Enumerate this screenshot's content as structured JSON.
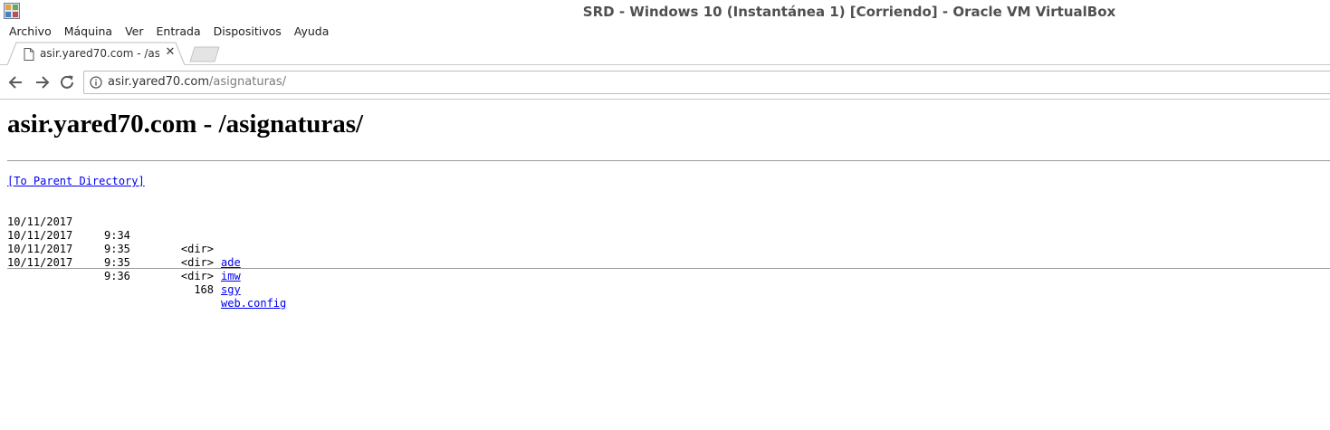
{
  "window": {
    "title": "SRD - Windows 10 (Instantánea 1) [Corriendo] - Oracle VM VirtualBox",
    "icon": "virtualbox-icon"
  },
  "menu": {
    "items": [
      "Archivo",
      "Máquina",
      "Ver",
      "Entrada",
      "Dispositivos",
      "Ayuda"
    ]
  },
  "browser": {
    "tab": {
      "title": "asir.yared70.com - /asignaturas/",
      "close_glyph": "✕",
      "favicon": "page-icon"
    },
    "toolbar": {
      "back_icon": "back-arrow-icon",
      "forward_icon": "forward-arrow-icon",
      "reload_icon": "reload-icon"
    },
    "address": {
      "host": "asir.yared70.com",
      "path": "/asignaturas/",
      "info_icon": "info-icon"
    }
  },
  "page": {
    "heading": "asir.yared70.com - /asignaturas/",
    "parent_link": "[To Parent Directory]",
    "entries": [
      {
        "date": "10/11/2017",
        "time": "9:34",
        "size": "<dir>",
        "name": "ade"
      },
      {
        "date": "10/11/2017",
        "time": "9:35",
        "size": "<dir>",
        "name": "imw"
      },
      {
        "date": "10/11/2017",
        "time": "9:35",
        "size": "<dir>",
        "name": "sgy"
      },
      {
        "date": "10/11/2017",
        "time": "9:36",
        "size": "168",
        "name": "web.config"
      }
    ]
  },
  "colors": {
    "link": "#0000ee",
    "title_text": "#505050",
    "rule": "#9a9a9a"
  }
}
